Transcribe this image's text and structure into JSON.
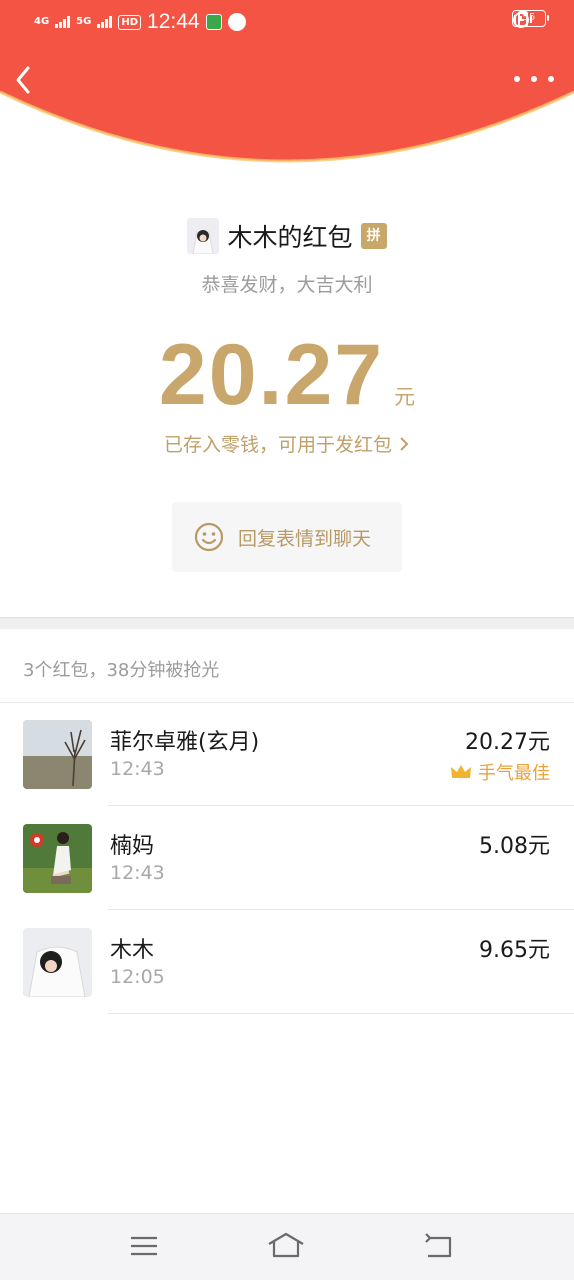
{
  "status_bar": {
    "net1": "4G",
    "net2": "5G",
    "hd": "HD",
    "time": "12:44",
    "battery": "55"
  },
  "header": {
    "bg_color": "#f35444",
    "back_icon": "chevron-left-icon",
    "more_icon": "more-dots-icon"
  },
  "packet": {
    "sender": "木木的红包",
    "pin_badge": "拼",
    "wish": "恭喜发财，大吉大利",
    "amount": "20.27",
    "unit": "元",
    "stored_link": "已存入零钱，可用于发红包",
    "reply_button": "回复表情到聊天"
  },
  "summary": "3个红包，38分钟被抢光",
  "records": [
    {
      "name": "菲尔卓雅(玄月)",
      "time": "12:43",
      "amount": "20.27元",
      "best": "手气最佳"
    },
    {
      "name": "楠妈",
      "time": "12:43",
      "amount": "5.08元"
    },
    {
      "name": "木木",
      "time": "12:05",
      "amount": "9.65元"
    }
  ],
  "colors": {
    "accent_gold": "#c8a66c",
    "best_orange": "#e8a33a"
  }
}
